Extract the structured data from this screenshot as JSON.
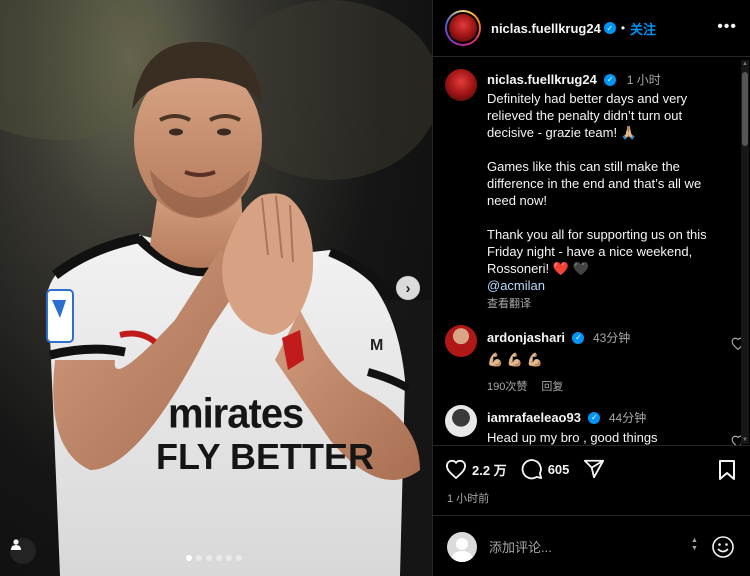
{
  "post": {
    "username": "niclas.fuellkrug24",
    "separator": "•",
    "follow_label": "关注",
    "more_label": "•••",
    "caption": {
      "username": "niclas.fuellkrug24",
      "time": "1 小时",
      "text": "Definitely had better days and very relieved the penalty didn’t turn out decisive - grazie team! 🙏🏼\n\nGames like this can still make the difference in the end and that’s all we need now!\n\nThank you all for supporting us on this Friday night - have a nice weekend, Rossoneri! ❤️ 🖤",
      "mention": "@acmilan",
      "translate_label": "查看翻译"
    },
    "comments": [
      {
        "username": "ardonjashari",
        "time": "43分钟",
        "text": "💪🏼 💪🏼 💪🏼",
        "likes": "190次赞",
        "reply_label": "回复"
      },
      {
        "username": "iamrafaeleao93",
        "time": "44分钟",
        "text": "Head up my bro , good things"
      }
    ],
    "likes_count": "2.2 万",
    "comments_count": "605",
    "posted_time": "1 小时前",
    "comment_placeholder": "添加评论...",
    "carousel": {
      "total": 6,
      "current": 1
    },
    "jersey": {
      "sponsor_line1": "mirates",
      "sponsor_line2": "FLY BETTER"
    }
  },
  "colors": {
    "accent": "#0095f6",
    "background": "#000000",
    "muted_text": "#a8a8a8"
  }
}
